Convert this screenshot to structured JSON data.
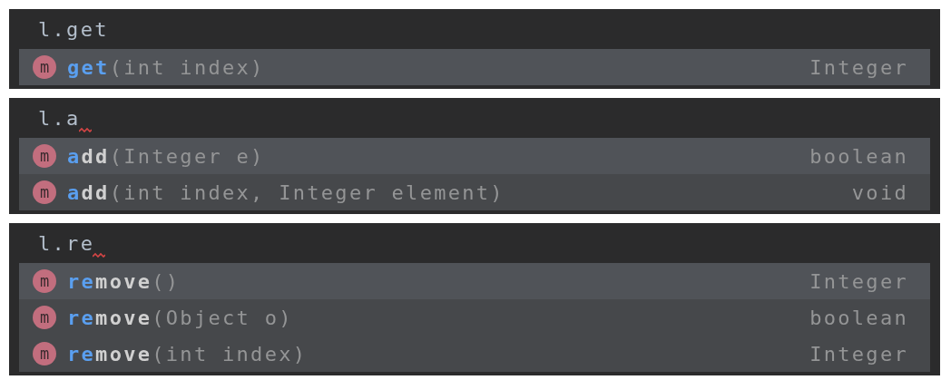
{
  "panels": [
    {
      "typed": "l.get",
      "error": false,
      "items": [
        {
          "icon": "m",
          "match": "get",
          "params": "(int index)",
          "type": "Integer",
          "selected": true
        }
      ]
    },
    {
      "typed": "l.a",
      "error": true,
      "items": [
        {
          "icon": "m",
          "match": "a",
          "rest": "dd",
          "params": "(Integer e)",
          "type": "boolean",
          "selected": true
        },
        {
          "icon": "m",
          "match": "a",
          "rest": "dd",
          "params": "(int index, Integer element)",
          "type": "void",
          "selected": false
        }
      ]
    },
    {
      "typed": "l.re",
      "error": true,
      "items": [
        {
          "icon": "m",
          "match": "re",
          "rest": "move",
          "params": "()",
          "type": "Integer",
          "selected": true
        },
        {
          "icon": "m",
          "match": "re",
          "rest": "move",
          "params": "(Object o)",
          "type": "boolean",
          "selected": false
        },
        {
          "icon": "m",
          "match": "re",
          "rest": "move",
          "params": "(int index)",
          "type": "Integer",
          "selected": false
        }
      ]
    }
  ]
}
